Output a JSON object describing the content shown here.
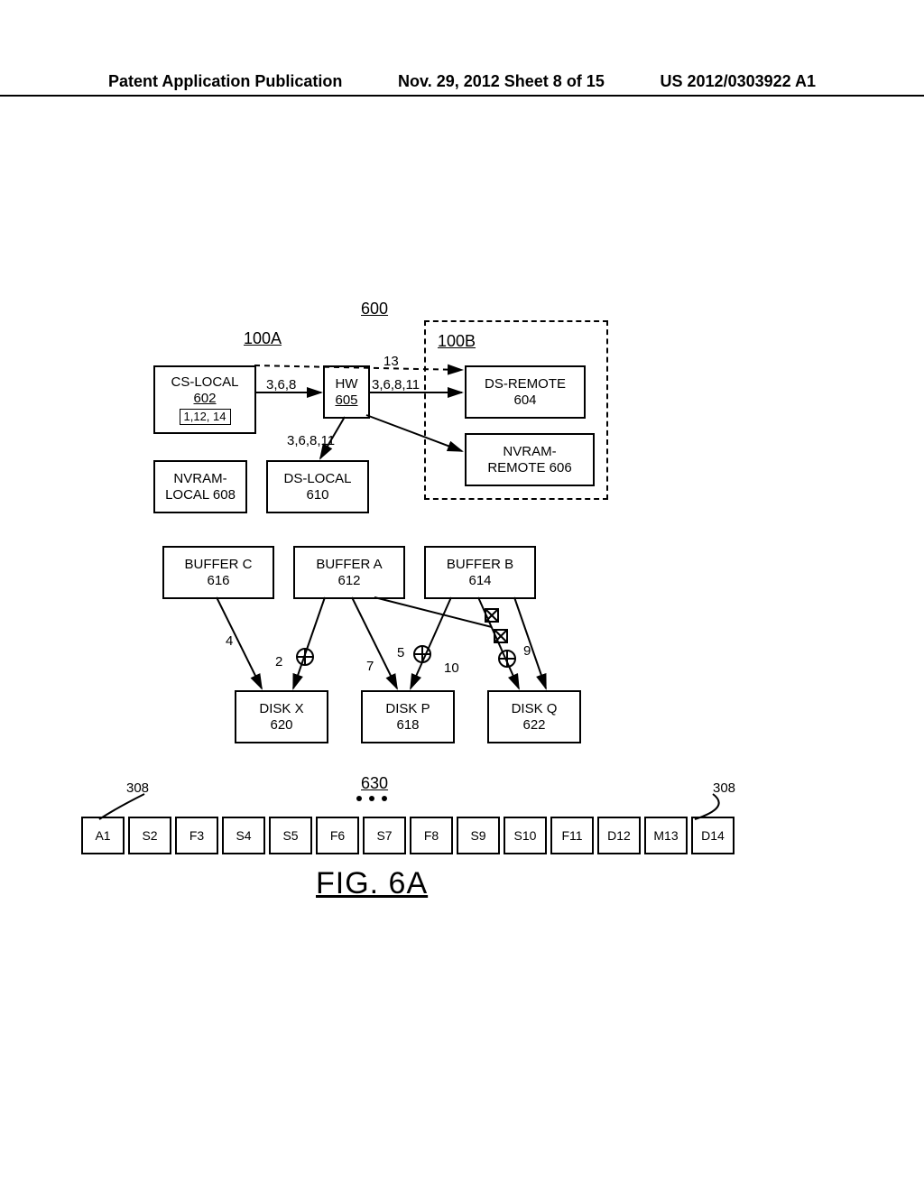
{
  "header": {
    "left": "Patent Application Publication",
    "middle": "Nov. 29, 2012  Sheet 8 of 15",
    "right": "US 2012/0303922 A1"
  },
  "fig_top_label": "600",
  "system_a": "100A",
  "system_b": "100B",
  "cs_local": {
    "line1": "CS-LOCAL",
    "line2": "602",
    "inner": "1,12, 14"
  },
  "hw": {
    "line1": "HW",
    "line2": "605"
  },
  "ds_remote": {
    "line1": "DS-REMOTE",
    "line2": "604"
  },
  "nvram_remote": {
    "line1": "NVRAM-",
    "line2": "REMOTE 606"
  },
  "nvram_local": {
    "line1": "NVRAM-",
    "line2": "LOCAL 608"
  },
  "ds_local": {
    "line1": "DS-LOCAL",
    "line2": "610"
  },
  "edge_labels": {
    "hw_in": "3,6,8",
    "hw_out": "3,6,8,11",
    "hw_to_dslocal": "3,6,8,11",
    "dashed_to_dsremote": "13"
  },
  "buffer_c": {
    "line1": "BUFFER C",
    "line2": "616"
  },
  "buffer_a": {
    "line1": "BUFFER A",
    "line2": "612"
  },
  "buffer_b": {
    "line1": "BUFFER B",
    "line2": "614"
  },
  "disk_x": {
    "line1": "DISK X",
    "line2": "620"
  },
  "disk_p": {
    "line1": "DISK P",
    "line2": "618"
  },
  "disk_q": {
    "line1": "DISK Q",
    "line2": "622"
  },
  "buf_disk_labels": {
    "n4": "4",
    "n2": "2",
    "n7": "7",
    "n5": "5",
    "n10": "10",
    "n9": "9"
  },
  "seq_label": "630",
  "leader_label": "308",
  "seq": [
    "A1",
    "S2",
    "F3",
    "S4",
    "S5",
    "F6",
    "S7",
    "F8",
    "S9",
    "S10",
    "F11",
    "D12",
    "M13",
    "D14"
  ],
  "figure_title": "FIG. 6A"
}
